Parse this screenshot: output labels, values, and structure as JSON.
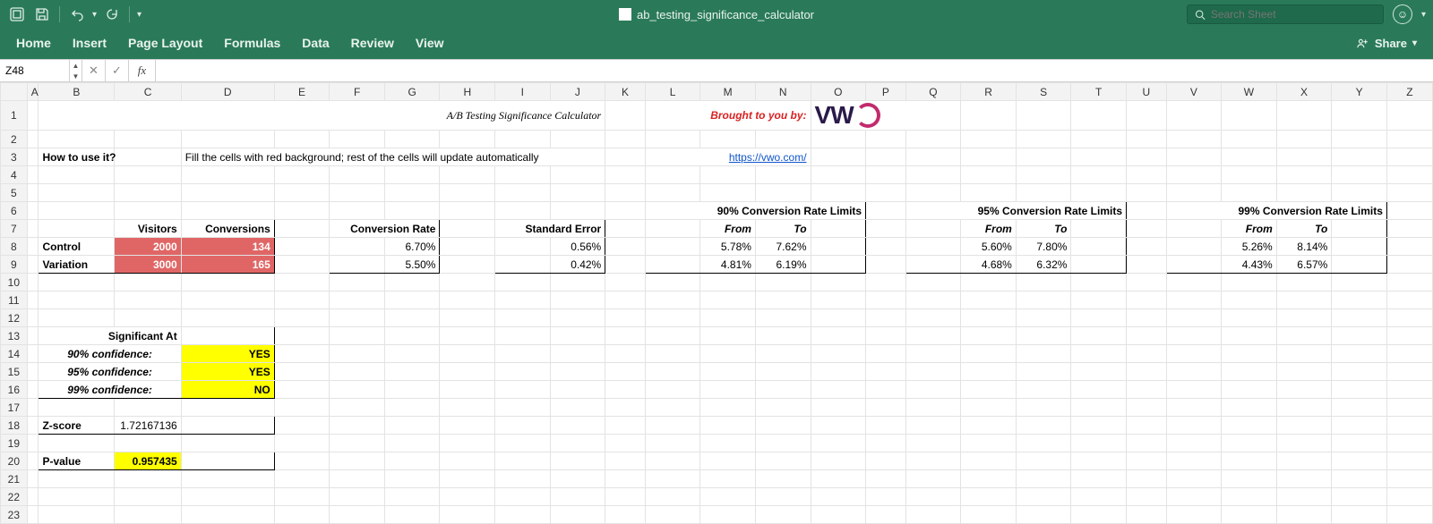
{
  "app": {
    "doc_title": "ab_testing_significance_calculator",
    "search_placeholder": "Search Sheet",
    "share_label": "Share",
    "tabs": [
      "Home",
      "Insert",
      "Page Layout",
      "Formulas",
      "Data",
      "Review",
      "View"
    ]
  },
  "formula_bar": {
    "name_box": "Z48",
    "formula": ""
  },
  "columns": [
    "A",
    "B",
    "C",
    "D",
    "E",
    "F",
    "G",
    "H",
    "I",
    "J",
    "K",
    "L",
    "M",
    "N",
    "O",
    "P",
    "Q",
    "R",
    "S",
    "T",
    "U",
    "V",
    "W",
    "X",
    "Y",
    "Z"
  ],
  "rows_visible": 23,
  "selected_cell": "Z48",
  "sheet": {
    "title": "A/B Testing Significance Calculator",
    "brought_by": "Brought to you by:",
    "logo_text": "VWO",
    "how_to_label": "How to use it?",
    "how_to_text": "Fill the cells with red background; rest of the cells will update automatically",
    "link": "https://vwo.com/",
    "input_table": {
      "headers": [
        "Visitors",
        "Conversions"
      ],
      "rows": [
        {
          "label": "Control",
          "visitors": "2000",
          "conversions": "134"
        },
        {
          "label": "Variation",
          "visitors": "3000",
          "conversions": "165"
        }
      ]
    },
    "conv_rate": {
      "header": "Conversion Rate",
      "values": [
        "6.70%",
        "5.50%"
      ]
    },
    "std_error": {
      "header": "Standard Error",
      "values": [
        "0.56%",
        "0.42%"
      ]
    },
    "limits": [
      {
        "title": "90% Conversion Rate Limits",
        "from_label": "From",
        "to_label": "To",
        "rows": [
          {
            "from": "5.78%",
            "to": "7.62%"
          },
          {
            "from": "4.81%",
            "to": "6.19%"
          }
        ]
      },
      {
        "title": "95% Conversion Rate Limits",
        "from_label": "From",
        "to_label": "To",
        "rows": [
          {
            "from": "5.60%",
            "to": "7.80%"
          },
          {
            "from": "4.68%",
            "to": "6.32%"
          }
        ]
      },
      {
        "title": "99% Conversion Rate Limits",
        "from_label": "From",
        "to_label": "To",
        "rows": [
          {
            "from": "5.26%",
            "to": "8.14%"
          },
          {
            "from": "4.43%",
            "to": "6.57%"
          }
        ]
      }
    ],
    "significance": {
      "title": "Significant At",
      "rows": [
        {
          "label": "90% confidence:",
          "value": "YES"
        },
        {
          "label": "95% confidence:",
          "value": "YES"
        },
        {
          "label": "99% confidence:",
          "value": "NO"
        }
      ]
    },
    "zscore": {
      "label": "Z-score",
      "value": "1.72167136"
    },
    "pvalue": {
      "label": "P-value",
      "value": "0.957435"
    }
  }
}
